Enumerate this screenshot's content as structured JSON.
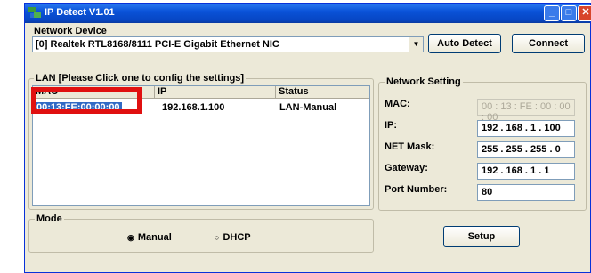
{
  "window": {
    "title": "IP Detect V1.01",
    "app_icon": "network-app-icon"
  },
  "titlebar_buttons": {
    "minimize": "minimize-icon",
    "maximize": "maximize-icon",
    "close": "close-icon"
  },
  "network_device": {
    "label": "Network Device",
    "selected": "[0] Realtek RTL8168/8111 PCI-E Gigabit Ethernet NIC",
    "auto_detect_label": "Auto Detect",
    "connect_label": "Connect"
  },
  "lan": {
    "label": "LAN [Please Click one to config the settings]",
    "columns": [
      "MAC",
      "IP",
      "Status"
    ],
    "rows": [
      {
        "mac": "00:13:FE:00:00:00",
        "ip": "192.168.1.100",
        "status": "LAN-Manual"
      }
    ]
  },
  "network_setting": {
    "label": "Network Setting",
    "mac_label": "MAC:",
    "mac_value": "00 : 13 : FE : 00 : 00 : 00",
    "ip_label": "IP:",
    "ip_value": "192 . 168 .   1 . 100",
    "mask_label": "NET Mask:",
    "mask_value": "255 . 255 . 255 . 0",
    "gateway_label": "Gateway:",
    "gateway_value": "192 . 168 . 1 . 1",
    "port_label": "Port Number:",
    "port_value": "80"
  },
  "mode": {
    "label": "Mode",
    "manual_label": "Manual",
    "dhcp_label": "DHCP",
    "selected": "Manual"
  },
  "setup_label": "Setup",
  "colors": {
    "highlight": "#e01010",
    "selection": "#316ac5",
    "titlebar": "#0a52d8"
  }
}
